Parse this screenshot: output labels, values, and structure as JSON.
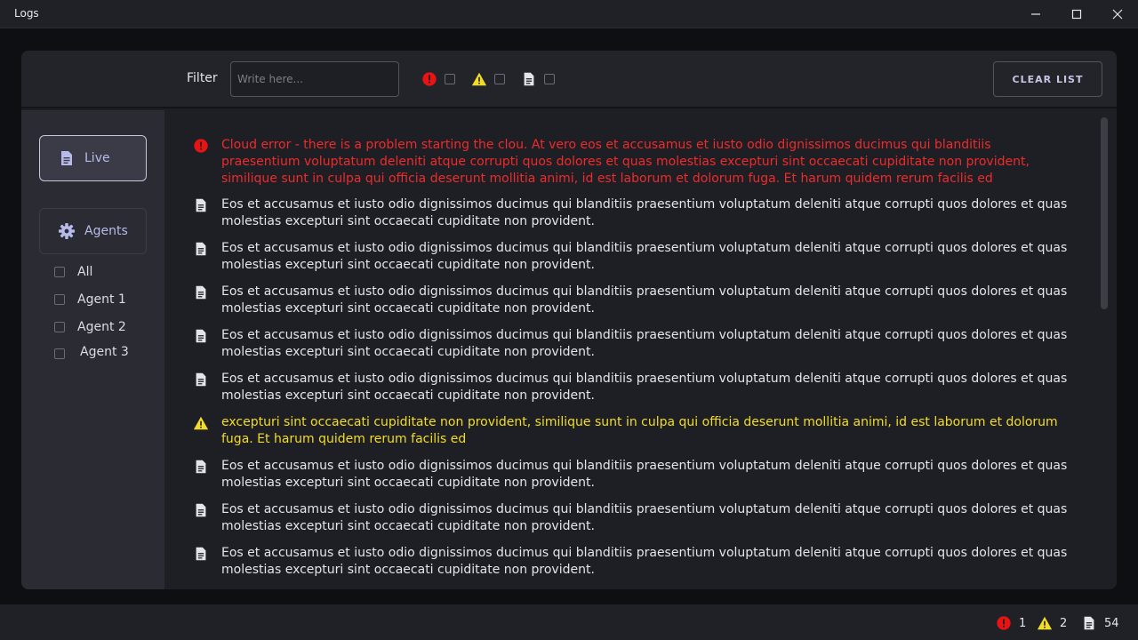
{
  "window": {
    "title": "Logs"
  },
  "toolbar": {
    "filter_label": "Filter",
    "filter_placeholder": "Write here...",
    "filter_value": "",
    "clear_label": "CLEAR LIST",
    "toggles": [
      {
        "icon": "error-icon",
        "checked": false
      },
      {
        "icon": "warning-icon",
        "checked": false
      },
      {
        "icon": "document-icon",
        "checked": false
      }
    ]
  },
  "sidebar": {
    "live_label": "Live",
    "agents_label": "Agents",
    "agents": [
      {
        "label": "All",
        "checked": false
      },
      {
        "label": "Agent 1",
        "checked": false
      },
      {
        "label": "Agent 2",
        "checked": false
      },
      {
        "label": "Agent 3",
        "checked": false
      }
    ]
  },
  "logs": [
    {
      "level": "error",
      "text": "Cloud error - there is a problem starting the clou. At vero eos et accusamus et iusto odio dignissimos ducimus qui blanditiis praesentium voluptatum deleniti atque corrupti quos dolores et quas molestias excepturi sint occaecati cupiditate non provident, similique sunt in culpa qui officia deserunt mollitia animi, id est laborum et dolorum fuga. Et harum quidem rerum facilis ed"
    },
    {
      "level": "info",
      "text": "Eos et accusamus et iusto odio dignissimos ducimus qui blanditiis praesentium voluptatum deleniti atque corrupti quos dolores et quas molestias excepturi sint occaecati cupiditate non provident."
    },
    {
      "level": "info",
      "text": "Eos et accusamus et iusto odio dignissimos ducimus qui blanditiis praesentium voluptatum deleniti atque corrupti quos dolores et quas molestias excepturi sint occaecati cupiditate non provident."
    },
    {
      "level": "info",
      "text": "Eos et accusamus et iusto odio dignissimos ducimus qui blanditiis praesentium voluptatum deleniti atque corrupti quos dolores et quas molestias excepturi sint occaecati cupiditate non provident."
    },
    {
      "level": "info",
      "text": "Eos et accusamus et iusto odio dignissimos ducimus qui blanditiis praesentium voluptatum deleniti atque corrupti quos dolores et quas molestias excepturi sint occaecati cupiditate non provident."
    },
    {
      "level": "info",
      "text": "Eos et accusamus et iusto odio dignissimos ducimus qui blanditiis praesentium voluptatum deleniti atque corrupti quos dolores et quas molestias excepturi sint occaecati cupiditate non provident."
    },
    {
      "level": "warning",
      "text": "excepturi sint occaecati cupiditate non provident, similique sunt in culpa qui officia deserunt mollitia animi, id est laborum et dolorum fuga. Et harum quidem rerum facilis ed"
    },
    {
      "level": "info",
      "text": "Eos et accusamus et iusto odio dignissimos ducimus qui blanditiis praesentium voluptatum deleniti atque corrupti quos dolores et quas molestias excepturi sint occaecati cupiditate non provident."
    },
    {
      "level": "info",
      "text": "Eos et accusamus et iusto odio dignissimos ducimus qui blanditiis praesentium voluptatum deleniti atque corrupti quos dolores et quas molestias excepturi sint occaecati cupiditate non provident."
    },
    {
      "level": "info",
      "text": "Eos et accusamus et iusto odio dignissimos ducimus qui blanditiis praesentium voluptatum deleniti atque corrupti quos dolores et quas molestias excepturi sint occaecati cupiditate non provident."
    }
  ],
  "status": {
    "errors": "1",
    "warnings": "2",
    "infos": "54"
  },
  "colors": {
    "error": "#ee2b2b",
    "warning": "#f2dc28",
    "info": "#e4e5e9",
    "accent": "#b8bbea"
  }
}
